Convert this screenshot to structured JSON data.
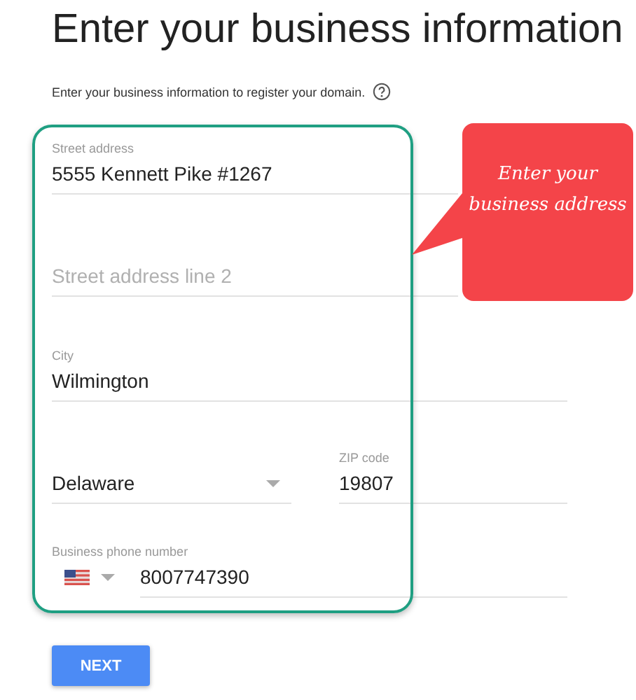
{
  "title": "Enter your business information",
  "subtitle": "Enter your business information to register your domain.",
  "fields": [
    {
      "kind": "text",
      "label": "Street address",
      "value": "5555 Kennett Pike #1267"
    },
    {
      "kind": "text",
      "placeholder": "Street address line 2"
    },
    {
      "kind": "text",
      "label": "City",
      "value": "Wilmington"
    }
  ],
  "state_select": {
    "value": "Delaware"
  },
  "zip": {
    "label": "ZIP code",
    "value": "19807"
  },
  "phone": {
    "label": "Business phone number",
    "value": "8007747390"
  },
  "callout": {
    "text": "Enter your business address"
  },
  "buttons": [
    {
      "label": "NEXT"
    }
  ]
}
